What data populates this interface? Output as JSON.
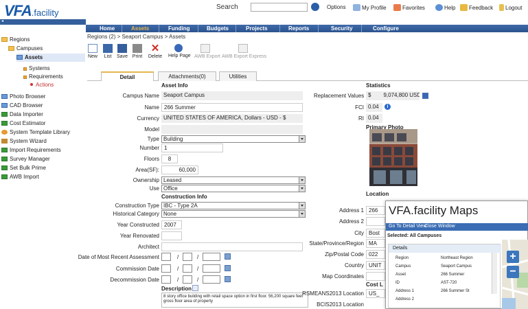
{
  "logo": {
    "text": "VFA",
    "suffix": ".facility"
  },
  "topbar": {
    "search_label": "Search",
    "search_value": "",
    "links": [
      "Options",
      "My Profile",
      "Favorites",
      "Help",
      "Feedback",
      "Logout"
    ]
  },
  "nav": {
    "items": [
      "Home",
      "Assets",
      "Funding",
      "Budgets",
      "Projects",
      "Reports",
      "Security",
      "Configure"
    ],
    "active": "Assets",
    "active_color": "#e6b650"
  },
  "sidebar": {
    "items": [
      "Regions",
      "Campuses",
      "Assets",
      "Systems",
      "Requirements",
      "Actions",
      "Photo Browser",
      "CAD Browser",
      "Data Importer",
      "Cost Estimator",
      "System Template Library",
      "System Wizard",
      "Import Requirements",
      "Survey Manager",
      "Set Bulk Prime",
      "AWB Import"
    ]
  },
  "breadcrumb": "Regions (2) > Seaport Campus > Assets",
  "toolbar": {
    "buttons": [
      "New",
      "List",
      "Save",
      "Print",
      "Delete",
      "Help Page",
      "AWB Export",
      "AWB Export Express"
    ]
  },
  "tabs": [
    "Detail",
    "Attachments(0)",
    "Utilities"
  ],
  "asset_info": {
    "heading": "Asset Info",
    "campus_name_label": "Campus Name",
    "campus_name": "Seaport Campus",
    "name_label": "Name",
    "name": "266 Summer",
    "currency_label": "Currency",
    "currency": "UNITED STATES OF AMERICA, Dollars - USD - $",
    "model_label": "Model",
    "model": "",
    "type_label": "Type",
    "type": "Building",
    "number_label": "Number",
    "number": "1",
    "floors_label": "Floors",
    "floors": "8",
    "area_label": "Area(SF):",
    "area": "60,000",
    "ownership_label": "Ownership",
    "ownership": "Leased",
    "use_label": "Use",
    "use": "Office"
  },
  "construction_info": {
    "heading": "Construction Info",
    "construction_type_label": "Construction Type",
    "construction_type": "IBC - Type 2A",
    "historical_category_label": "Historical Category",
    "historical_category": "None",
    "year_constructed_label": "Year Constructed",
    "year_constructed": "2007",
    "year_renovated_label": "Year Renovated",
    "year_renovated": "",
    "architect_label": "Architect",
    "architect": "",
    "date_recent_assessment_label": "Date of Most Recent Assessment",
    "commission_date_label": "Commission Date",
    "decommission_date_label": "Decommission Date",
    "description_label": "Description",
    "description": "8 story office building with retail space option in first floor.  56,200 square feet gross floor area of property"
  },
  "statistics": {
    "heading": "Statistics",
    "replacement_label": "Replacement Values",
    "replacement_currency": "$",
    "replacement_value": "9,074,800",
    "replacement_unit": "USD",
    "fci_label": "FCI",
    "fci": "0.04",
    "ri_label": "RI",
    "ri": "0.04",
    "photo_label": "Primary Photo"
  },
  "location": {
    "heading": "Location",
    "address1_label": "Address 1",
    "address1": "266",
    "address2_label": "Address 2",
    "address2": "",
    "city_label": "City",
    "city": "Bost",
    "state_label": "State/Province/Region",
    "state": "MA",
    "zip_label": "Zip/Postal Code",
    "zip": "022",
    "country_label": "Country",
    "country": "UNIT",
    "map_coordinates_label": "Map Coordinates",
    "cost_label": "Cost L",
    "rsmeans_label": "RSMEANS2013 Location",
    "rsmeans": "US_",
    "bcis_label": "BCIS2013 Location"
  },
  "maps_popup": {
    "title": "VFA.facility Maps",
    "links": [
      "Go To Detail View",
      "Close Window"
    ],
    "selected": "Selected: All Campuses",
    "panel_head": "Details",
    "rows": [
      {
        "label": "Region",
        "value": "Northeast Region"
      },
      {
        "label": "Campus",
        "value": "Seaport Campus"
      },
      {
        "label": "Asset",
        "value": "266 Summer"
      },
      {
        "label": "ID",
        "value": "AST-720"
      },
      {
        "label": "Address 1",
        "value": "266 Summer St"
      },
      {
        "label": "Address 2",
        "value": ""
      }
    ],
    "zoom_in": "+",
    "zoom_out": "−"
  }
}
